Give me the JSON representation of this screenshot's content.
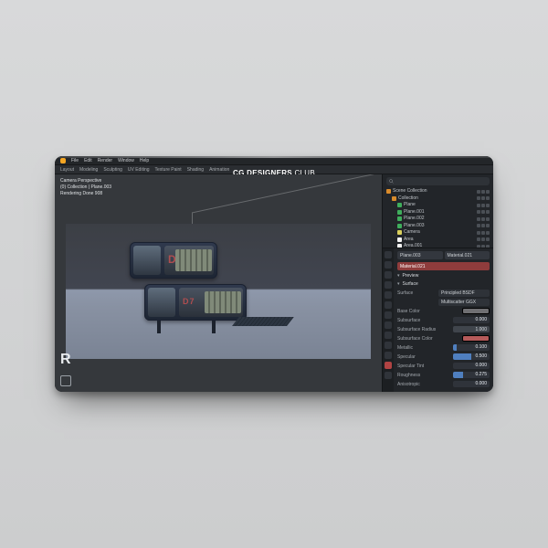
{
  "menu": [
    "File",
    "Edit",
    "Render",
    "Window",
    "Help"
  ],
  "workspaces": [
    "Layout",
    "Modeling",
    "Sculpting",
    "UV Editing",
    "Texture Paint",
    "Shading",
    "Animation"
  ],
  "brand_bold": "CG DESIGNERS",
  "brand_light": ".CLUB",
  "viewport": {
    "line1": "Camera Perspective",
    "line2": "(0) Collection | Plane.003",
    "line3": "Rendering Done 908"
  },
  "decal_top": "D7",
  "decal_bot": "D7",
  "side_letter": "R",
  "outliner": {
    "search_placeholder": "",
    "items": [
      {
        "depth": 0,
        "icon": "col",
        "label": "Scene Collection"
      },
      {
        "depth": 1,
        "icon": "col",
        "label": "Collection"
      },
      {
        "depth": 2,
        "icon": "mesh",
        "label": "Plane"
      },
      {
        "depth": 2,
        "icon": "mesh",
        "label": "Plane.001"
      },
      {
        "depth": 2,
        "icon": "mesh",
        "label": "Plane.002"
      },
      {
        "depth": 2,
        "icon": "mesh",
        "label": "Plane.003"
      },
      {
        "depth": 2,
        "icon": "cam",
        "label": "Camera"
      },
      {
        "depth": 2,
        "icon": "light",
        "label": "Area"
      },
      {
        "depth": 2,
        "icon": "light",
        "label": "Area.001"
      }
    ]
  },
  "props": {
    "crumb_left": "Plane.003",
    "crumb_right": "Material.021",
    "material_chip": "Material.021",
    "preview_header": "Preview",
    "surface_header": "Surface",
    "surface_label": "Surface",
    "surface_value": "Principled BSDF",
    "dist_label": "",
    "dist_value": "Multiscatter GGX",
    "base_color_label": "Base Color",
    "base_color_hex": "#6f6f72",
    "subsurface_label": "Subsurface",
    "subsurface_value": "0.000",
    "subsurface_radius_label": "Subsurface Radius",
    "subsurface_radius_value": "1.000",
    "subsurface_color_label": "Subsurface Color",
    "subsurface_color_hex": "#b55a5a",
    "metallic_label": "Metallic",
    "metallic_value": "0.100",
    "specular_label": "Specular",
    "specular_value": "0.500",
    "specular_tint_label": "Specular Tint",
    "specular_tint_value": "0.000",
    "roughness_label": "Roughness",
    "roughness_value": "0.275",
    "anisotropic_label": "Anisotropic",
    "anisotropic_value": "0.000"
  }
}
